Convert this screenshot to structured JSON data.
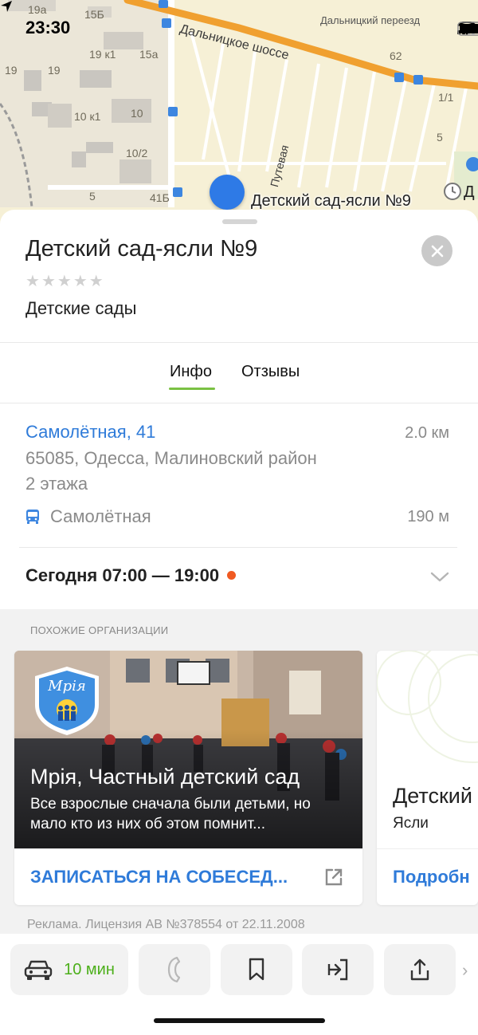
{
  "status_bar": {
    "time": "23:30",
    "icons": [
      "location-arrow-icon",
      "signal-icon",
      "wifi-icon",
      "battery-icon"
    ]
  },
  "map": {
    "road_main": "Дальницкое шоссе",
    "road_side": "Путевая",
    "place_top_right": "Дальницкий переезд",
    "house_numbers": [
      "19а",
      "15Б",
      "19 к1",
      "15а",
      "19",
      "19",
      "10 к1",
      "10",
      "10/2",
      "5",
      "41Б",
      "62",
      "1/1",
      "5"
    ],
    "poi_label": "Детский сад-ясли №9",
    "edge_label": "Д"
  },
  "place": {
    "title": "Детский сад-ясли №9",
    "rating_stars": 5,
    "category": "Детские сады"
  },
  "tabs": [
    {
      "label": "Инфо",
      "active": true
    },
    {
      "label": "Отзывы",
      "active": false
    }
  ],
  "info": {
    "address": "Самолётная, 41",
    "distance": "2.0 км",
    "address_full": "65085, Одесса, Малиновский район",
    "floors": "2 этажа",
    "stop_name": "Самолётная",
    "stop_distance": "190 м",
    "hours": "Сегодня 07:00 — 19:00"
  },
  "similar": {
    "title": "ПОХОЖИЕ ОРГАНИЗАЦИИ",
    "cards": [
      {
        "title": "Мрія, Частный детский сад",
        "description": "Все взрослые сначала были детьми, но мало кто из них об этом помнит...",
        "cta": "ЗАПИСАТЬСЯ НА СОБЕСЕД...",
        "logo_text": "Мрія"
      },
      {
        "title": "Детский",
        "subtitle": "Ясли",
        "cta": "Подробн"
      }
    ],
    "ad_text": "Реклама. Лицензия АВ №378554 от 22.11.2008"
  },
  "actions": {
    "route_time": "10 мин",
    "icons": [
      "car-icon",
      "phone-icon",
      "bookmark-icon",
      "enter-icon",
      "share-icon"
    ]
  },
  "colors": {
    "link": "#2f7bd9",
    "accent_green": "#7ac143",
    "route_green": "#4caf1a",
    "hours_dot": "#f05a22",
    "pin": "#2e7ae6",
    "map_bg": "#f6f0d6",
    "road": "#f0a030"
  }
}
